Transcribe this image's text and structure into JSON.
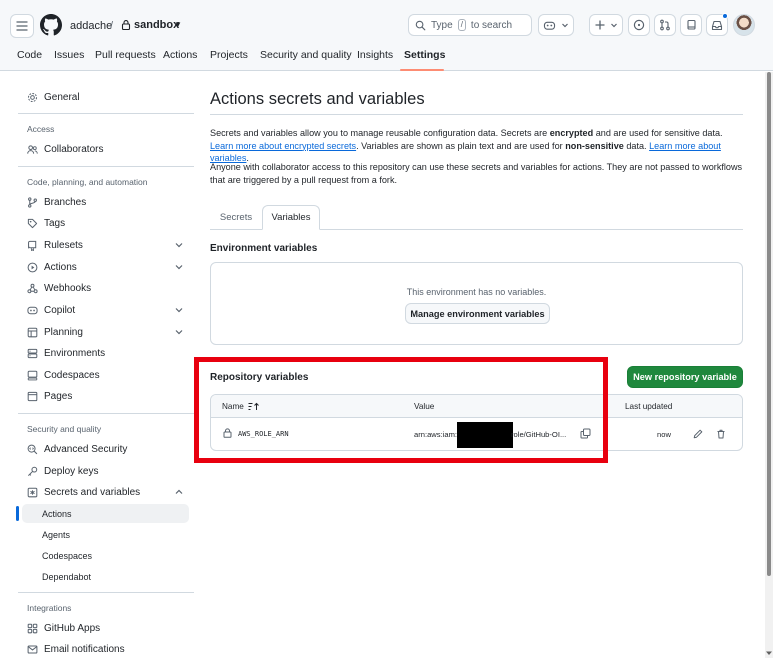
{
  "header": {
    "owner": "addache",
    "separator": "/",
    "repo": "sandbox",
    "search_placeholder": "Type / to search",
    "search_prefix": "Type",
    "search_key": "/",
    "search_suffix": "to search"
  },
  "repo_nav": {
    "items": [
      "Code",
      "Issues",
      "Pull requests",
      "Actions",
      "Projects",
      "Security and quality",
      "Insights",
      "Settings"
    ],
    "active": "Settings"
  },
  "sidebar": {
    "general": "General",
    "access_heading": "Access",
    "collaborators": "Collaborators",
    "cpa_heading": "Code, planning, and automation",
    "branches": "Branches",
    "tags": "Tags",
    "rulesets": "Rulesets",
    "actions": "Actions",
    "webhooks": "Webhooks",
    "copilot": "Copilot",
    "planning": "Planning",
    "environments": "Environments",
    "codespaces": "Codespaces",
    "pages": "Pages",
    "security_heading": "Security and quality",
    "advanced_security": "Advanced Security",
    "deploy_keys": "Deploy keys",
    "secrets_and_variables": "Secrets and variables",
    "sub_actions": "Actions",
    "sub_agents": "Agents",
    "sub_codespaces": "Codespaces",
    "sub_dependabot": "Dependabot",
    "integrations_heading": "Integrations",
    "github_apps": "GitHub Apps",
    "email_notifications": "Email notifications"
  },
  "main": {
    "title": "Actions secrets and variables",
    "intro_1": "Secrets and variables allow you to manage reusable configuration data. Secrets are ",
    "intro_encrypted": "encrypted",
    "intro_2": " and are used for sensitive data. ",
    "intro_link_1": "Learn more about encrypted secrets",
    "intro_3": ". Variables are shown as plain text and are used for ",
    "intro_nonsensitive": "non-sensitive",
    "intro_4": " data. ",
    "intro_link_2": "Learn more about variables",
    "intro_5": ".",
    "access_note": "Anyone with collaborator access to this repository can use these secrets and variables for actions. They are not passed to workflows that are triggered by a pull request from a fork.",
    "tabs": [
      "Secrets",
      "Variables"
    ],
    "active_tab": "Variables",
    "env_title": "Environment variables",
    "env_empty": "This environment has no variables.",
    "env_button": "Manage environment variables",
    "repo_title": "Repository variables",
    "new_var_button": "New repository variable",
    "columns": {
      "name": "Name",
      "value": "Value",
      "last_updated": "Last updated"
    },
    "rows": [
      {
        "name": "AWS_ROLE_ARN",
        "value_left": "arn:aws:iam:",
        "value_right": "role/GitHub-OI...",
        "updated": "now"
      }
    ]
  },
  "colors": {
    "primary_button": "#1f883d",
    "link": "#0969da",
    "active_tab_underline": "#fd8c73",
    "highlight_box": "#e8000f"
  }
}
